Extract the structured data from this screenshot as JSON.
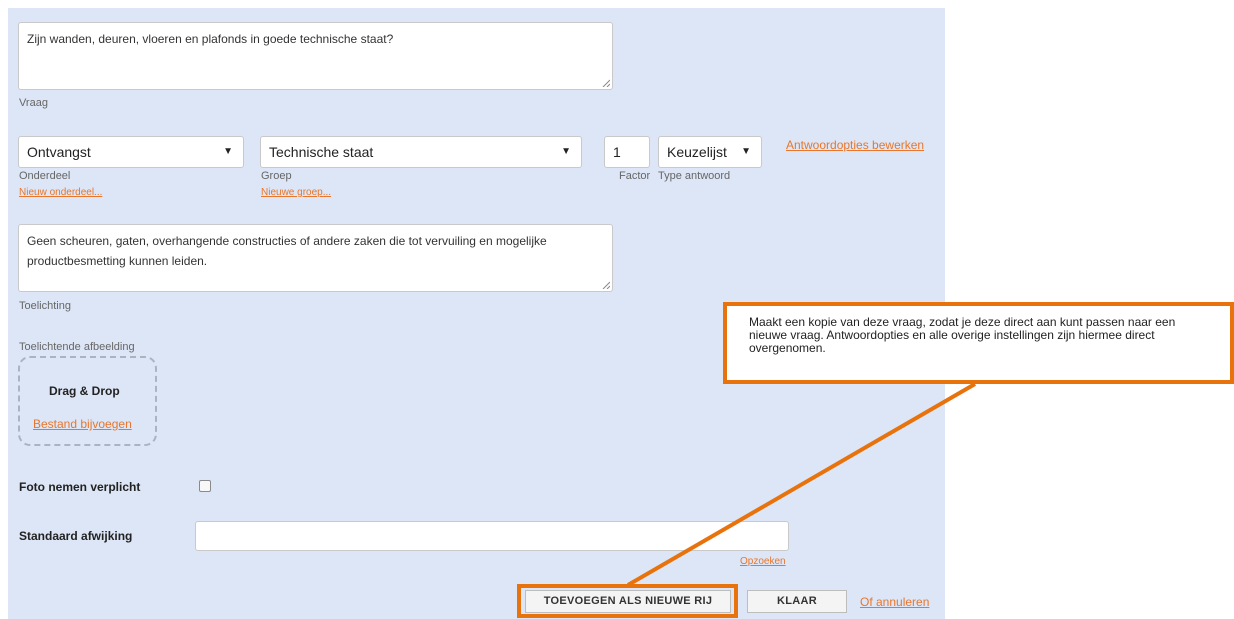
{
  "question": {
    "value": "Zijn wanden, deuren, vloeren en plafonds in goede technische staat?",
    "label": "Vraag"
  },
  "onderdeel": {
    "value": "Ontvangst",
    "label": "Onderdeel",
    "new_link": "Nieuw onderdeel..."
  },
  "groep": {
    "value": "Technische staat",
    "label": "Groep",
    "new_link": "Nieuwe groep..."
  },
  "factor": {
    "value": "1",
    "label": "Factor"
  },
  "answer_type": {
    "value": "Keuzelijst",
    "label": "Type antwoord"
  },
  "edit_options_link": "Antwoordopties bewerken",
  "toelichting": {
    "value": "Geen scheuren, gaten, overhangende constructies of andere zaken die tot vervuiling en mogelijke productbesmetting kunnen leiden.",
    "label": "Toelichting"
  },
  "image": {
    "label": "Toelichtende afbeelding",
    "drop_label": "Drag & Drop",
    "attach_link": "Bestand bijvoegen"
  },
  "photo_required": {
    "label": "Foto nemen verplicht",
    "checked": false
  },
  "standard_deviation": {
    "label": "Standaard afwijking",
    "value": "",
    "lookup_link": "Opzoeken"
  },
  "buttons": {
    "add_row": "TOEVOEGEN ALS NIEUWE RIJ",
    "done": "KLAAR",
    "cancel": "Of annuleren"
  },
  "callout": {
    "text": "Maakt een kopie van deze vraag, zodat je deze direct aan kunt passen naar een nieuwe vraag. Antwoordopties en alle overige instellingen zijn hiermee direct overgenomen."
  },
  "colors": {
    "panel": "#dde6f6",
    "accent": "#e8762c",
    "highlight": "#e8730c"
  }
}
